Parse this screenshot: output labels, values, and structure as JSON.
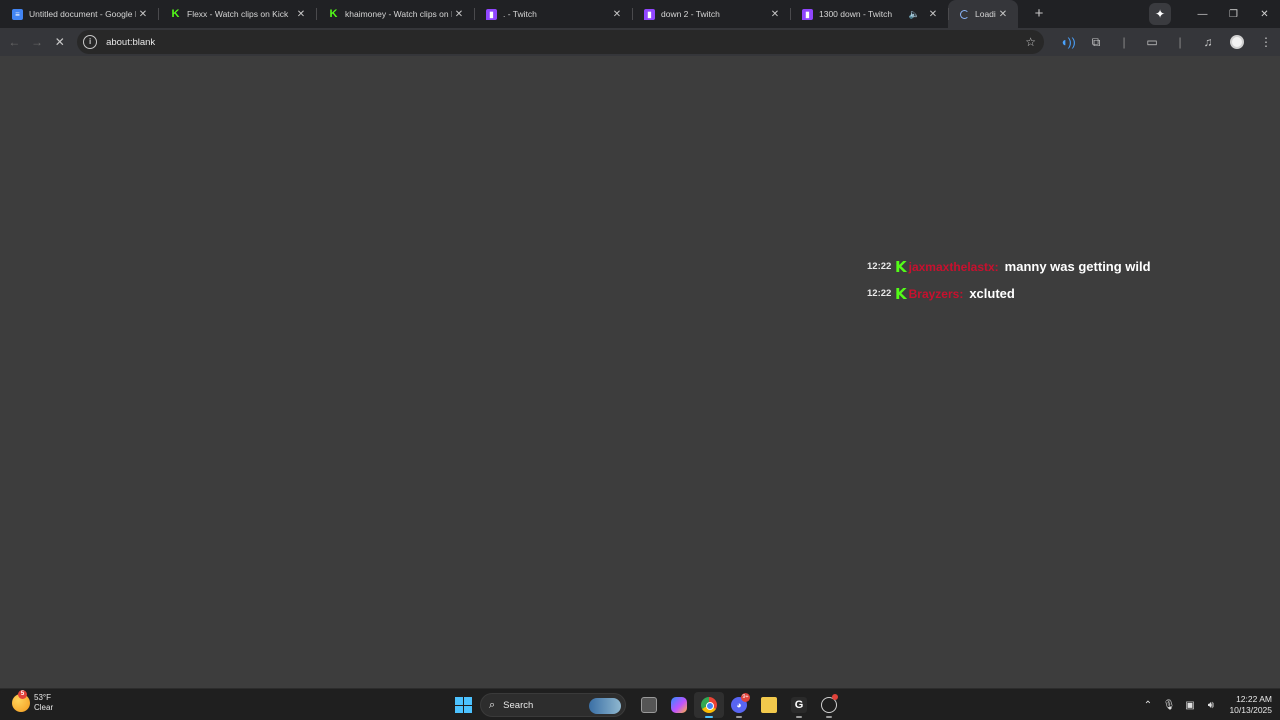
{
  "tabs": [
    {
      "title": "Untitled document - Google Docs",
      "favicon": "docs-icon",
      "active": false,
      "audio": false
    },
    {
      "title": "Flexx - Watch clips on Kick",
      "favicon": "kick-icon",
      "active": false,
      "audio": false
    },
    {
      "title": "khaimoney - Watch clips on Kick",
      "favicon": "kick-icon",
      "active": false,
      "audio": false
    },
    {
      "title": ". - Twitch",
      "favicon": "twitch-icon",
      "active": false,
      "audio": false
    },
    {
      "title": "down 2 - Twitch",
      "favicon": "twitch-icon",
      "active": false,
      "audio": false
    },
    {
      "title": "1300 down - Twitch",
      "favicon": "twitch-icon",
      "active": false,
      "audio": true
    },
    {
      "title": "Loading...",
      "favicon": "loading-spinner-icon",
      "active": true,
      "audio": false
    }
  ],
  "toolbar": {
    "url": "about:blank"
  },
  "chat": {
    "messages": [
      {
        "time": "12:22",
        "user": "jaxmaxthelastx:",
        "text": "manny was getting wild"
      },
      {
        "time": "12:22",
        "user": "Brayzers:",
        "text": "xcluted"
      }
    ]
  },
  "taskbar": {
    "weather_temp": "53°F",
    "weather_cond": "Clear",
    "weather_badge": "5",
    "search_label": "Search",
    "discord_badge": "9+",
    "time": "12:22 AM",
    "date": "10/13/2025"
  },
  "colors": {
    "page_bg": "#3d3d3d",
    "kick_green": "#53fc18",
    "username_red": "#c8102e",
    "accent_blue": "#4cc2ff"
  }
}
